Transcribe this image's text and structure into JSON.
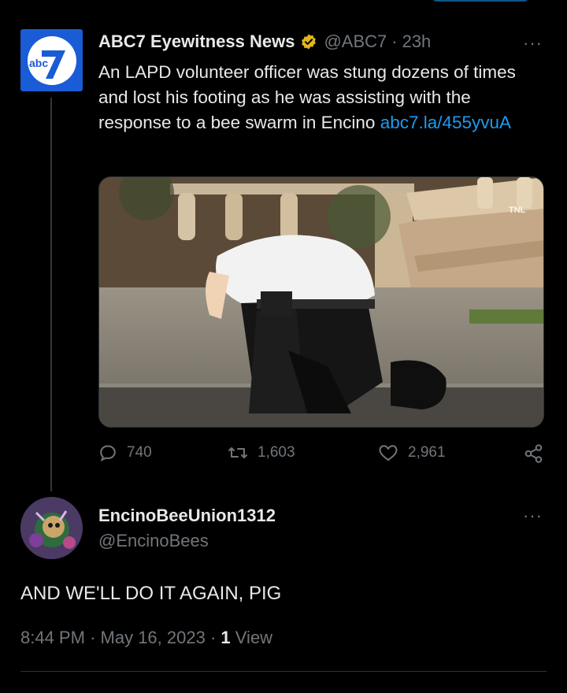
{
  "parent_tweet": {
    "author_name": "ABC7 Eyewitness News",
    "author_handle": "@ABC7",
    "separator": "·",
    "time_ago": "23h",
    "text_main": "An LAPD volunteer officer was stung dozens of times and lost his footing as he was assisting with the response to a bee swarm in Encino ",
    "text_link": "abc7.la/455yvuA",
    "avatar_logo_text": "abc",
    "media_watermark": "TNL",
    "stats": {
      "replies": "740",
      "retweets": "1,603",
      "likes": "2,961"
    }
  },
  "reply": {
    "author_name": "EncinoBeeUnion1312",
    "author_handle": "@EncinoBees",
    "text": "AND WE'LL DO IT AGAIN, PIG",
    "time": "8:44 PM",
    "date": "May 16, 2023",
    "views_count": "1",
    "views_label": "View"
  },
  "icons": [
    "more-icon",
    "verified-badge-icon",
    "reply-icon",
    "retweet-icon",
    "like-icon",
    "share-icon"
  ],
  "colors": {
    "background": "#000000",
    "text": "#e7e9ea",
    "muted": "#71767b",
    "link": "#1d9bf0",
    "verified_gold": "#e2b719",
    "abc_blue": "#1a5bd6"
  }
}
